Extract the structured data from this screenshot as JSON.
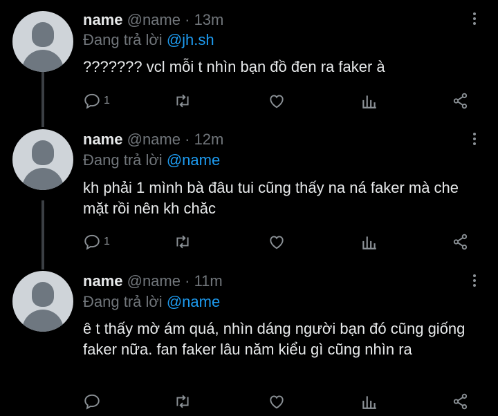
{
  "tweets": [
    {
      "name": "name",
      "handle": "@name",
      "dot": "·",
      "time": "13m",
      "replying_prefix": "Đang trả lời",
      "replying_to": "@jh.sh",
      "text": "??????? vcl mỗi t nhìn bạn đồ đen ra faker à",
      "reply_count": "1"
    },
    {
      "name": "name",
      "handle": "@name",
      "dot": "·",
      "time": "12m",
      "replying_prefix": "Đang trả lời",
      "replying_to": "@name",
      "text": "kh phải 1 mình bà đâu tui cũng thấy na ná faker mà che mặt rồi nên kh chăc",
      "reply_count": "1"
    },
    {
      "name": "name",
      "handle": "@name",
      "dot": "·",
      "time": "11m",
      "replying_prefix": "Đang trả lời",
      "replying_to": "@name",
      "text": "ê t thấy mờ ám quá, nhìn dáng người bạn đó cũng giống faker nữa. fan faker lâu năm kiểu gì cũng nhìn ra",
      "reply_count": ""
    }
  ],
  "icons": [
    "reply-icon",
    "retweet-icon",
    "like-icon",
    "analytics-icon",
    "share-icon",
    "more-options-icon"
  ],
  "colors": {
    "background": "#000000",
    "text": "#e7e9ea",
    "muted": "#71767b",
    "link": "#1d9bf0",
    "thread": "#3b3f44"
  }
}
